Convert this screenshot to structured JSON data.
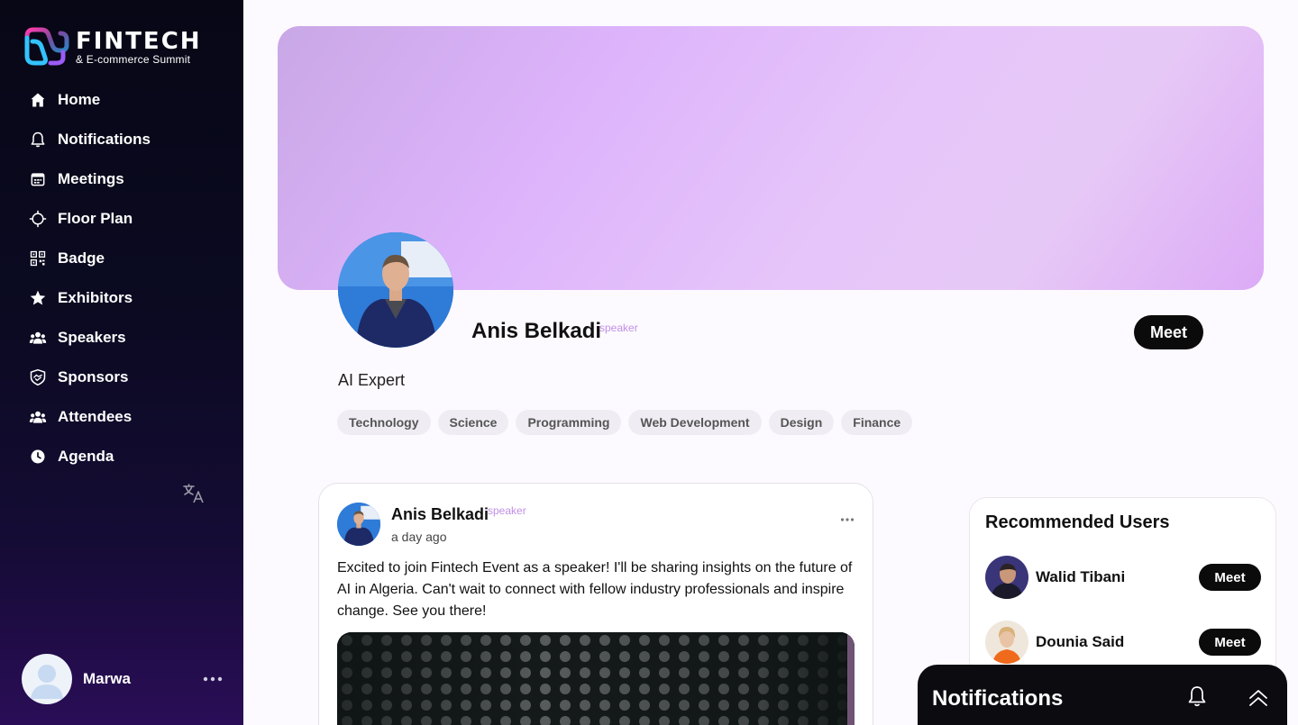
{
  "app": {
    "logo_title": "FINTECH",
    "logo_subtitle": "& E-commerce Summit"
  },
  "sidebar": {
    "items": [
      {
        "label": "Home",
        "icon": "home-icon"
      },
      {
        "label": "Notifications",
        "icon": "bell-icon"
      },
      {
        "label": "Meetings",
        "icon": "calendar-icon"
      },
      {
        "label": "Floor Plan",
        "icon": "crosshair-icon"
      },
      {
        "label": "Badge",
        "icon": "qr-code-icon"
      },
      {
        "label": "Exhibitors",
        "icon": "star-icon"
      },
      {
        "label": "Speakers",
        "icon": "users-icon"
      },
      {
        "label": "Sponsors",
        "icon": "handshake-icon"
      },
      {
        "label": "Attendees",
        "icon": "users-icon"
      },
      {
        "label": "Agenda",
        "icon": "clock-icon"
      }
    ],
    "translate_icon": "translate-icon",
    "user": {
      "name": "Marwa"
    }
  },
  "profile": {
    "name": "Anis Belkadi",
    "role": "speaker",
    "title": "AI Expert",
    "meet_label": "Meet",
    "tags": [
      "Technology",
      "Science",
      "Programming",
      "Web Development",
      "Design",
      "Finance"
    ]
  },
  "post": {
    "author": "Anis Belkadi",
    "role": "speaker",
    "time": "a day ago",
    "text": "Excited to join Fintech Event as a speaker! I'll be sharing insights on the future of AI in Algeria. Can't wait to connect with fellow industry professionals and inspire change. See you there!"
  },
  "recommended": {
    "title": "Recommended Users",
    "users": [
      {
        "name": "Walid Tibani",
        "meet_label": "Meet"
      },
      {
        "name": "Dounia Said",
        "meet_label": "Meet"
      }
    ]
  },
  "notifications_panel": {
    "title": "Notifications"
  },
  "colors": {
    "sidebar_bg": "#0b0a22",
    "accent_purple": "#c08fe6",
    "button_black": "#0b0b0b"
  }
}
